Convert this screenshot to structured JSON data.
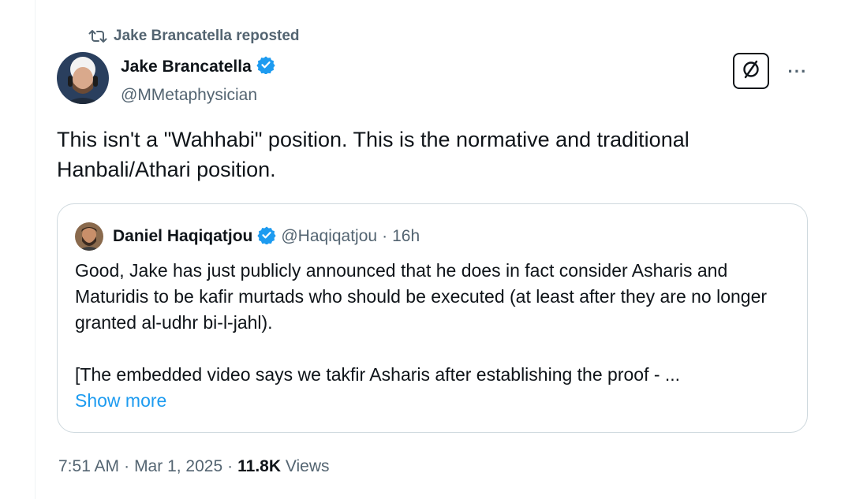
{
  "repost": {
    "icon": "repost-icon",
    "label": "Jake Brancatella reposted"
  },
  "author": {
    "display_name": "Jake Brancatella",
    "handle": "@MMetaphysician",
    "verified": true
  },
  "actions": {
    "grok_icon": "grok-icon",
    "more_icon": "more-horizontal-icon",
    "more_label": "···"
  },
  "tweet": {
    "text": "This isn't a \"Wahhabi\" position. This is the normative and traditional Hanbali/Athari position."
  },
  "quote": {
    "display_name": "Daniel Haqiqatjou",
    "handle": "@Haqiqatjou",
    "separator": "·",
    "time": "16h",
    "text": "Good, Jake has just publicly announced that he does in fact consider Asharis and Maturidis to be kafir murtads who should be executed (at least after they are no longer granted al-udhr bi-l-jahl).\n\n[The embedded video says we takfir Asharis after establishing the proof - ...",
    "show_more": "Show more"
  },
  "meta": {
    "time": "7:51 AM",
    "sep1": "·",
    "date": "Mar 1, 2025",
    "sep2": "·",
    "views_count": "11.8K",
    "views_label": "Views"
  },
  "colors": {
    "text": "#0f1419",
    "secondary": "#536471",
    "link": "#1d9bf0",
    "border": "#cfd9de",
    "verified": "#1d9bf0"
  }
}
